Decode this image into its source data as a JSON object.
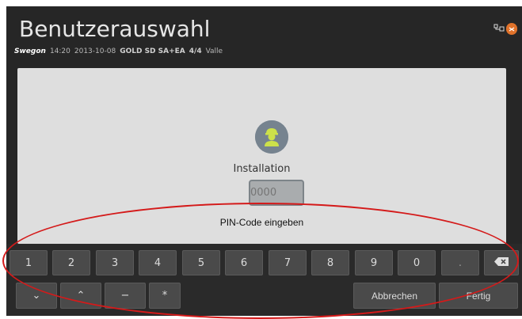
{
  "header": {
    "title": "Benutzerauswahl",
    "brand": "Swegon",
    "time": "14:20",
    "date": "2013-10-08",
    "unit": "GOLD SD SA+EA",
    "page": "4/4",
    "mode": "Valle"
  },
  "icons": {
    "network": "network-icon",
    "alarm": "alarm-icon",
    "user": "installer-user-icon",
    "backspace": "backspace-icon"
  },
  "colors": {
    "accent_alarm": "#e0722a",
    "annotation": "#d41a1a"
  },
  "login": {
    "role": "Installation",
    "pin_placeholder": "0000",
    "prompt": "PIN-Code eingeben"
  },
  "keyboard": {
    "row1": [
      "1",
      "2",
      "3",
      "4",
      "5",
      "6",
      "7",
      "8",
      "9",
      "0",
      "."
    ],
    "row2": {
      "down": "⌄",
      "up": "⌃",
      "minus": "−",
      "star": "*",
      "cancel": "Abbrechen",
      "done": "Fertig"
    }
  }
}
